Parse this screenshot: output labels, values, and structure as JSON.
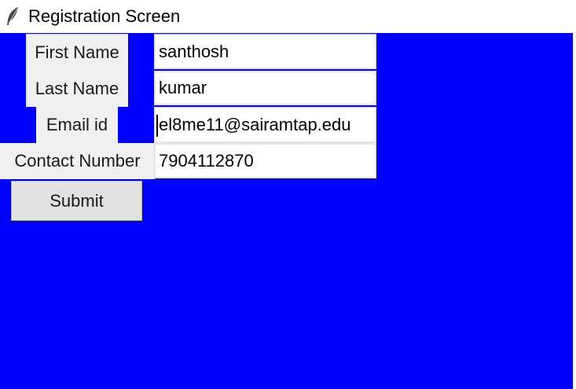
{
  "window": {
    "title": "Registration Screen",
    "icon": "feather-icon",
    "background_color": "#0000ff"
  },
  "form": {
    "first_name": {
      "label": "First Name",
      "value": "santhosh"
    },
    "last_name": {
      "label": "Last Name",
      "value": "kumar"
    },
    "email": {
      "label": "Email id",
      "value": "el8me11@sairamtap.edu"
    },
    "contact": {
      "label": "Contact Number",
      "value": "7904112870"
    },
    "submit_label": "Submit"
  }
}
